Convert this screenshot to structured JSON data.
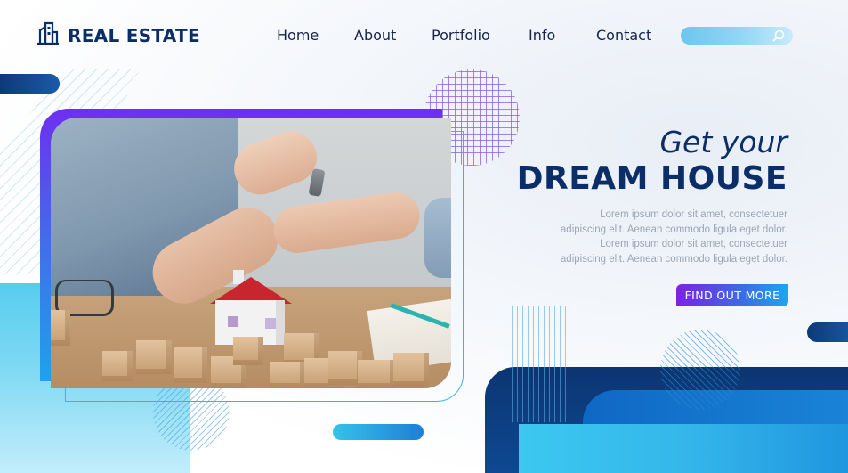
{
  "brand": {
    "name": "REAL ESTATE",
    "logo_icon": "building-icon",
    "color": "#0b2d68"
  },
  "nav": {
    "items": [
      {
        "label": "Home"
      },
      {
        "label": "About"
      },
      {
        "label": "Portfolio"
      },
      {
        "label": "Info"
      },
      {
        "label": "Contact"
      }
    ]
  },
  "search": {
    "icon": "search-icon"
  },
  "hero": {
    "tagline": "Get your",
    "title": "DREAM HOUSE",
    "body": "Lorem ipsum dolor sit amet, consectetuer adipiscing elit. Aenean commodo ligula eget dolor. Lorem ipsum dolor sit amet, consectetuer adipiscing elit. Aenean commodo ligula eget dolor.",
    "cta_label": "FIND OUT MORE"
  },
  "colors": {
    "primary": "#0b2d68",
    "accent_purple": "#7a22e6",
    "accent_blue": "#1fa6ee",
    "accent_cyan": "#35c3e8"
  }
}
